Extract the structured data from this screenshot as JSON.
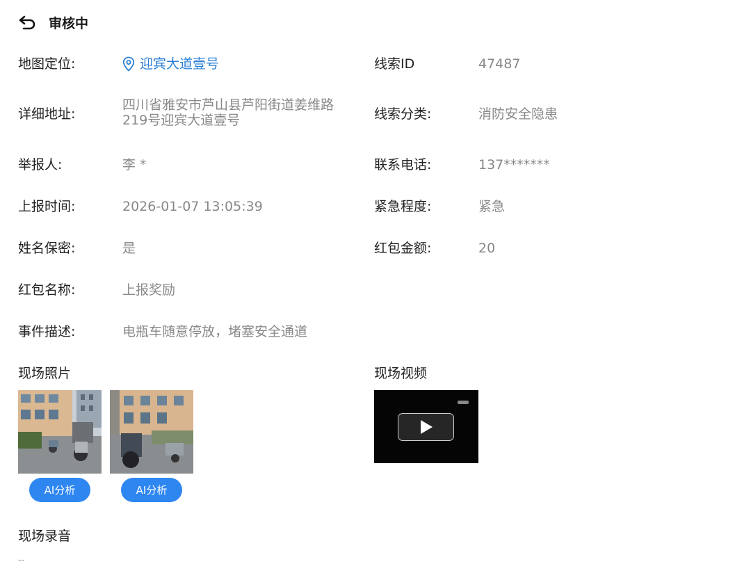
{
  "header": {
    "title": "审核中"
  },
  "fields": {
    "map_location": {
      "label": "地图定位:",
      "value": "迎宾大道壹号"
    },
    "clue_id": {
      "label": "线索ID",
      "value": "47487"
    },
    "address": {
      "label": "详细地址:",
      "value": "四川省雅安市芦山县芦阳街道姜维路219号迎宾大道壹号"
    },
    "category": {
      "label": "线索分类:",
      "value": "消防安全隐患"
    },
    "reporter": {
      "label": "举报人:",
      "value": "李 *"
    },
    "phone": {
      "label": "联系电话:",
      "value": "137*******"
    },
    "report_time": {
      "label": "上报时间:",
      "value": "2026-01-07 13:05:39"
    },
    "urgency": {
      "label": "紧急程度:",
      "value": "紧急"
    },
    "anonymous": {
      "label": "姓名保密:",
      "value": "是"
    },
    "redpacket_amount": {
      "label": "红包金额:",
      "value": "20"
    },
    "redpacket_name": {
      "label": "红包名称:",
      "value": "上报奖励"
    },
    "description": {
      "label": "事件描述:",
      "value": "电瓶车随意停放，堵塞安全通道"
    }
  },
  "media": {
    "photos_title": "现场照片",
    "ai_button_label": "AI分析",
    "video_title": "现场视频",
    "audio_title": "现场录音",
    "audio_value": "--"
  }
}
